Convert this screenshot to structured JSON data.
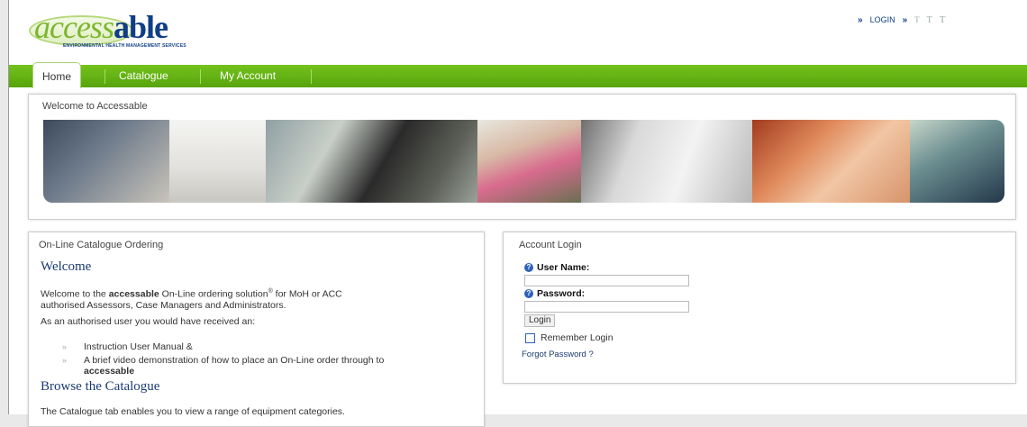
{
  "header": {
    "logo_text_a": "access",
    "logo_text_b": "able",
    "logo_tagline": "ENVIRONMENTAL HEALTH MANAGEMENT SERVICES",
    "login_link": "LOGIN",
    "text_size_labels": [
      "T",
      "T",
      "T"
    ]
  },
  "nav": {
    "tabs": [
      "Home",
      "Catalogue",
      "My Account"
    ],
    "active_index": 0
  },
  "welcome_panel": {
    "title": "Welcome to Accessable"
  },
  "catalogue_panel": {
    "title": "On-Line Catalogue Ordering",
    "heading": "Welcome",
    "intro_pre": "Welcome to the ",
    "intro_brand": "accessable",
    "intro_mid": " On-Line ordering solution",
    "intro_sup": "®",
    "intro_post": " for MoH or ACC",
    "intro_line2": "authorised Assessors, Case Managers and Administrators.",
    "received_text": "As an authorised user you would have received an:",
    "bullets": [
      "Instruction User Manual &",
      "A brief video demonstration of how to place an On-Line order through to"
    ],
    "bullet2_brand": "accessable",
    "browse_heading": "Browse the Catalogue",
    "browse_text": "The Catalogue tab enables you to view a range of equipment categories."
  },
  "login_panel": {
    "title": "Account Login",
    "username_label": "User Name:",
    "username_value": "",
    "password_label": "Password:",
    "password_value": "",
    "login_button": "Login",
    "remember_label": "Remember Login",
    "remember_checked": false,
    "forgot_link": "Forgot Password ?"
  },
  "colors": {
    "brand_green": "#6cb61c",
    "brand_blue": "#0f3e86"
  }
}
